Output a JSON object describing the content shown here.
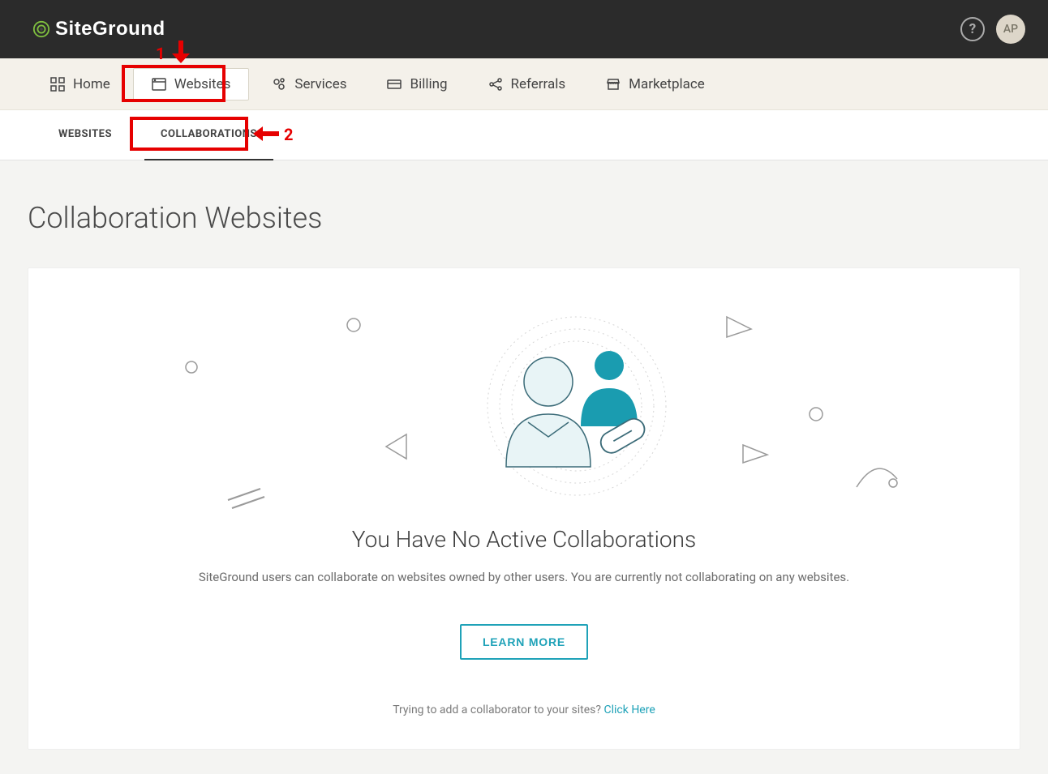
{
  "brand": "SiteGround",
  "topbar": {
    "avatar_initials": "AP"
  },
  "nav": {
    "items": [
      {
        "id": "home",
        "label": "Home"
      },
      {
        "id": "websites",
        "label": "Websites"
      },
      {
        "id": "services",
        "label": "Services"
      },
      {
        "id": "billing",
        "label": "Billing"
      },
      {
        "id": "referrals",
        "label": "Referrals"
      },
      {
        "id": "marketplace",
        "label": "Marketplace"
      }
    ],
    "active": "websites"
  },
  "subtabs": {
    "items": [
      {
        "id": "websites",
        "label": "WEBSITES"
      },
      {
        "id": "collaborations",
        "label": "COLLABORATIONS"
      }
    ],
    "active": "collaborations"
  },
  "page": {
    "title": "Collaboration Websites"
  },
  "empty_state": {
    "heading": "You Have No Active Collaborations",
    "description": "SiteGround users can collaborate on websites owned by other users. You are currently not collaborating on any websites.",
    "button_label": "LEARN MORE",
    "hint_prefix": "Trying to add a collaborator to your sites? ",
    "hint_link": "Click Here"
  },
  "annotations": {
    "num1": "1",
    "num2": "2"
  },
  "colors": {
    "accent": "#1fa2b8",
    "highlight": "#e60000"
  }
}
